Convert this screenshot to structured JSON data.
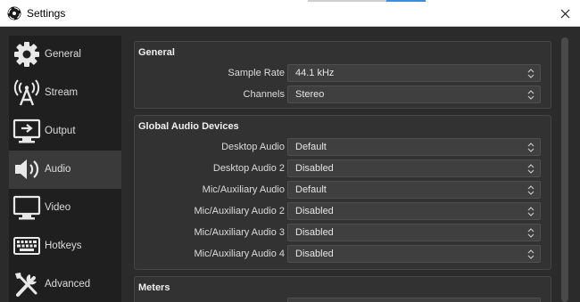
{
  "window": {
    "title": "Settings"
  },
  "sidebar": {
    "items": [
      {
        "label": "General",
        "icon": "gear-icon"
      },
      {
        "label": "Stream",
        "icon": "broadcast-icon"
      },
      {
        "label": "Output",
        "icon": "monitor-output-icon"
      },
      {
        "label": "Audio",
        "icon": "speaker-icon",
        "active": true
      },
      {
        "label": "Video",
        "icon": "monitor-icon"
      },
      {
        "label": "Hotkeys",
        "icon": "keyboard-icon"
      },
      {
        "label": "Advanced",
        "icon": "tools-icon"
      }
    ]
  },
  "general": {
    "title": "General",
    "sample_rate": {
      "label": "Sample Rate",
      "value": "44.1 kHz"
    },
    "channels": {
      "label": "Channels",
      "value": "Stereo"
    }
  },
  "devices": {
    "title": "Global Audio Devices",
    "rows": [
      {
        "label": "Desktop Audio",
        "value": "Default"
      },
      {
        "label": "Desktop Audio 2",
        "value": "Disabled"
      },
      {
        "label": "Mic/Auxiliary Audio",
        "value": "Default"
      },
      {
        "label": "Mic/Auxiliary Audio 2",
        "value": "Disabled"
      },
      {
        "label": "Mic/Auxiliary Audio 3",
        "value": "Disabled"
      },
      {
        "label": "Mic/Auxiliary Audio 4",
        "value": "Disabled"
      }
    ]
  },
  "meters": {
    "title": "Meters"
  },
  "colors": {
    "background": "#2b2b2b",
    "sidebar": "#1f1f1f",
    "active_item": "#3a3a3a",
    "field": "#3f3f3f"
  }
}
